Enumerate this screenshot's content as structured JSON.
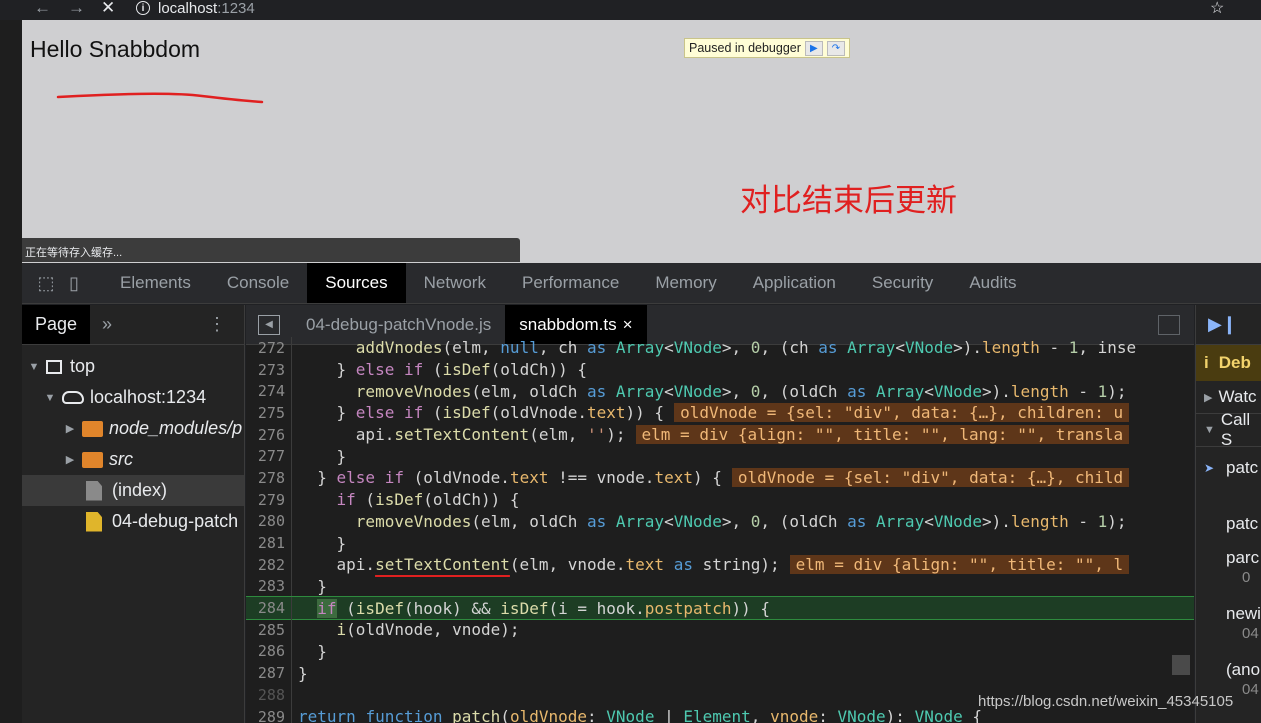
{
  "browser": {
    "nav_back": "←",
    "nav_forward": "→",
    "nav_stop": "✕",
    "url_host": "localhost",
    "url_port": ":1234",
    "star": "☆"
  },
  "page": {
    "heading": "Hello Snabbdom",
    "paused_label": "Paused in debugger",
    "annotation": "对比结束后更新",
    "status_text": "正在等待存入缓存..."
  },
  "devtools": {
    "tabs": [
      "Elements",
      "Console",
      "Sources",
      "Network",
      "Performance",
      "Memory",
      "Application",
      "Security",
      "Audits"
    ],
    "active_tab": "Sources"
  },
  "navigator": {
    "tab": "Page",
    "more": "»",
    "tree": [
      {
        "label": "top"
      },
      {
        "label": "localhost:1234"
      },
      {
        "label": "node_modules/p"
      },
      {
        "label": "src"
      },
      {
        "label": "(index)"
      },
      {
        "label": "04-debug-patch"
      }
    ]
  },
  "editor": {
    "tabs": [
      "04-debug-patchVnode.js",
      "snabbdom.ts"
    ],
    "close_icon": "×",
    "line_numbers": [
      "272",
      "273",
      "274",
      "275",
      "276",
      "277",
      "278",
      "279",
      "280",
      "281",
      "282",
      "283",
      "284",
      "285",
      "286",
      "287",
      "288",
      "289"
    ],
    "annotations": {
      "l275": "oldVnode = {sel: \"div\", data: {…}, children: u",
      "l276": "elm = div {align: \"\", title: \"\", lang: \"\", transla",
      "l278": "oldVnode = {sel: \"div\", data: {…}, child",
      "l282": "elm = div {align: \"\", title: \"\", l"
    }
  },
  "debugger": {
    "banner": "Deb",
    "sections": [
      "Watc",
      "Call S"
    ],
    "frames": [
      {
        "name": "patc",
        "sub": ""
      },
      {
        "name": "patc",
        "sub": ""
      },
      {
        "name": "parc",
        "sub": "0"
      },
      {
        "name": "newi",
        "sub": "04"
      },
      {
        "name": "(ano",
        "sub": "04"
      }
    ]
  },
  "watermark": "https://blog.csdn.net/weixin_45345105"
}
